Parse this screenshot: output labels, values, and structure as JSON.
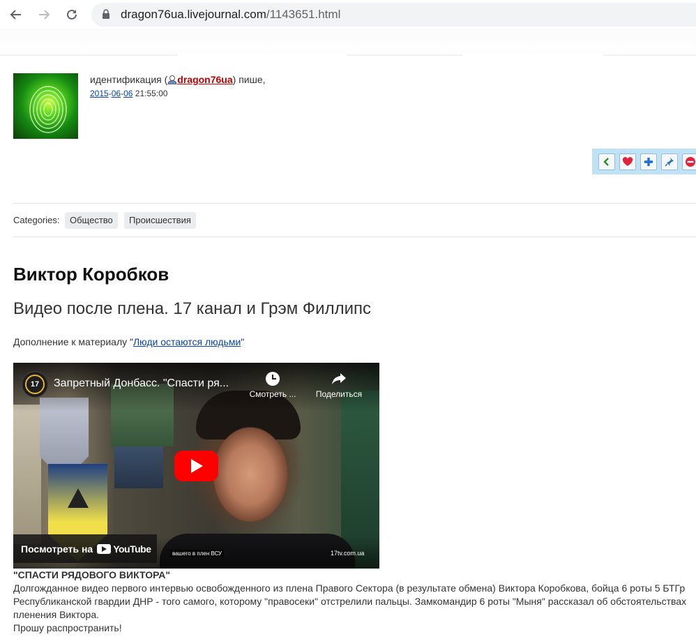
{
  "browser": {
    "url_host": "dragon76ua.livejournal.com",
    "url_path": "/1143651.html"
  },
  "post": {
    "author_prefix": "идентификация (",
    "username": "dragon76ua",
    "author_suffix": ") пише,",
    "date": {
      "year": "2015",
      "month": "06",
      "day": "06",
      "time": "21:55:00"
    },
    "categories_label": "Categories:",
    "categories": [
      "Общество",
      "Происшествия"
    ],
    "title": "Виктор Коробков",
    "subtitle": "Видео после плена. 17 канал и Грэм Филлипс",
    "addendum_prefix": "Дополнение к материалу \"",
    "addendum_link": "Люди остаются людьми",
    "addendum_suffix": "\"",
    "video": {
      "channel_badge": "17",
      "title": "Запретный Донбасс. \"Спасти ря...",
      "watch_later": "Смотреть ...",
      "share": "Поделиться",
      "watch_on": "Посмотреть на",
      "youtube": "YouTube",
      "caption": "вашего в плен ВСУ",
      "source": "17tv.com.ua"
    },
    "body_heading": "\"СПАСТИ РЯДОВОГО ВИКТОРА\"",
    "body_text": "Долгожданное видео первого интервью освобожденного из плена Правого Сектора (в результате обмена) Виктора Коробкова, бойца 6 роты 5 БТГр Республиканской гвардии ДНР - того самого, которому \"правосеки\" отстрелили пальцы. Замкомандир 6 роты \"Мыня\" рассказал об обстоятельствах пленения Виктора.",
    "body_footer": "Прошу распространить!"
  },
  "icons": {
    "back": "arrow-left-icon",
    "forward": "arrow-right-icon",
    "reload": "reload-icon",
    "lock": "lock-icon",
    "toolbar": [
      "chevron-left-icon",
      "heart-icon",
      "plus-icon",
      "pin-icon",
      "minus-icon"
    ]
  },
  "colors": {
    "username": "#c00000",
    "link": "#0645ad",
    "toolbar_bg": "#bfe2f6",
    "youtube_red": "#ff0000"
  }
}
